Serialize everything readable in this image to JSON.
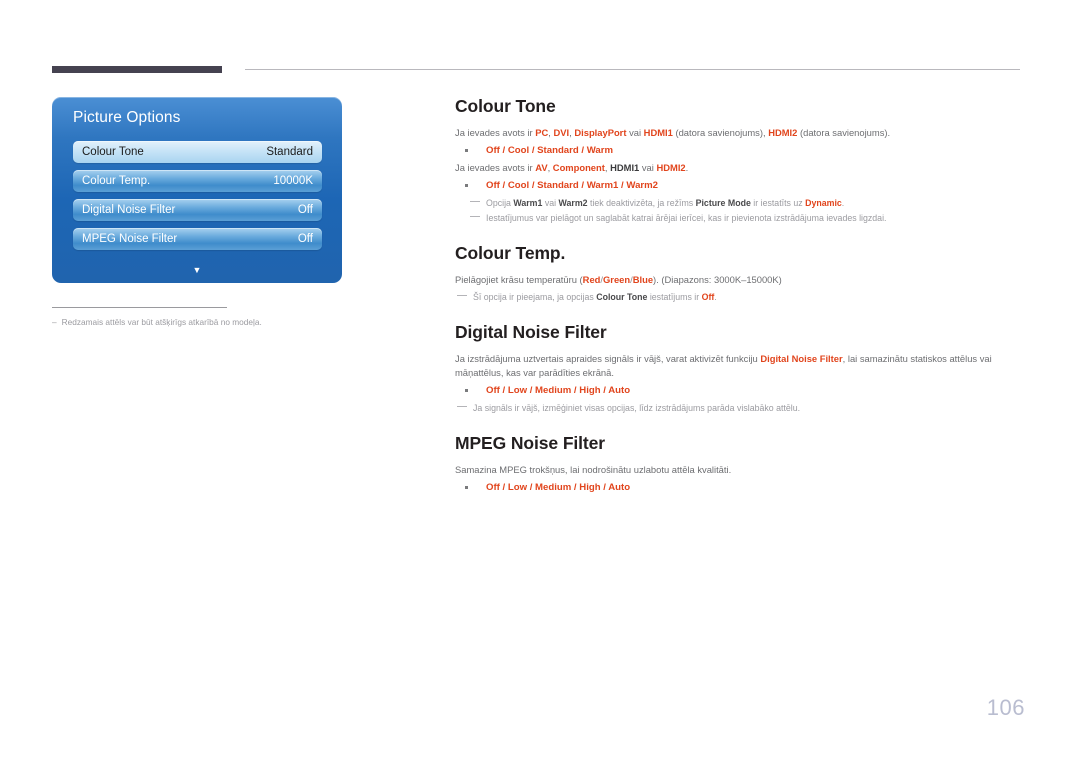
{
  "page": {
    "number": "106"
  },
  "osd": {
    "title": "Picture Options",
    "rows": [
      {
        "label": "Colour Tone",
        "value": "Standard",
        "selected": true
      },
      {
        "label": "Colour Temp.",
        "value": "10000K",
        "selected": false
      },
      {
        "label": "Digital Noise Filter",
        "value": "Off",
        "selected": false
      },
      {
        "label": "MPEG Noise Filter",
        "value": "Off",
        "selected": false
      }
    ],
    "scroll_arrow": "▼"
  },
  "caption": {
    "dash": "–",
    "text": "Redzamais attēls var būt atšķirīgs atkarībā no modeļa."
  },
  "sections": {
    "colour_tone": {
      "title": "Colour Tone",
      "p1_a": "Ja ievades avots ir ",
      "p1_pc": "PC",
      "p1_c1": ", ",
      "p1_dvi": "DVI",
      "p1_c2": ", ",
      "p1_dp": "DisplayPort",
      "p1_vai": " vai ",
      "p1_hdmi1": "HDMI1",
      "p1_paren1": " (datora savienojums), ",
      "p1_hdmi2": "HDMI2",
      "p1_paren2": " (datora savienojums).",
      "opt1": "Off / Cool / Standard / Warm",
      "p2_a": "Ja ievades avots ir ",
      "p2_av": "AV",
      "p2_c1": ", ",
      "p2_comp": "Component",
      "p2_c2": ", ",
      "p2_hdmi1": "HDMI1",
      "p2_vai": " vai ",
      "p2_hdmi2": "HDMI2",
      "p2_end": ".",
      "opt2": "Off / Cool / Standard / Warm1 / Warm2",
      "note1_a": "Opcija ",
      "note1_warm1": "Warm1",
      "note1_vai": " vai ",
      "note1_warm2": "Warm2",
      "note1_b": " tiek deaktivizēta, ja režīms ",
      "note1_pm": "Picture Mode",
      "note1_c": " ir iestatīts uz ",
      "note1_dyn": "Dynamic",
      "note1_d": ".",
      "note2": "Iestatījumus var pielāgot un saglabāt katrai ārējai ierīcei, kas ir pievienota izstrādājuma ievades ligzdai."
    },
    "colour_temp": {
      "title": "Colour Temp.",
      "p1_a": "Pielāgojiet krāsu temperatūru (",
      "p1_red": "Red",
      "p1_s1": "/",
      "p1_green": "Green",
      "p1_s2": "/",
      "p1_blue": "Blue",
      "p1_b": "). (Diapazons: 3000K–15000K)",
      "note1_a": "Šī opcija ir pieejama, ja opcijas ",
      "note1_ct": "Colour Tone",
      "note1_b": " iestatījums ir ",
      "note1_off": "Off",
      "note1_c": "."
    },
    "digital_noise_filter": {
      "title": "Digital Noise Filter",
      "p1_a": "Ja izstrādājuma uztvertais apraides signāls ir vājš, varat aktivizēt funkciju ",
      "p1_dnf": "Digital Noise Filter",
      "p1_b": ", lai samazinātu statiskos attēlus vai māņattēlus, kas var parādīties ekrānā.",
      "opt1": "Off / Low / Medium / High / Auto",
      "note1": "Ja signāls ir vājš, izmēģiniet visas opcijas, līdz izstrādājums parāda vislabāko attēlu."
    },
    "mpeg_noise_filter": {
      "title": "MPEG Noise Filter",
      "p1": "Samazina MPEG trokšņus, lai nodrošinātu uzlabotu attēla kvalitāti.",
      "opt1": "Off / Low / Medium / High / Auto"
    }
  }
}
